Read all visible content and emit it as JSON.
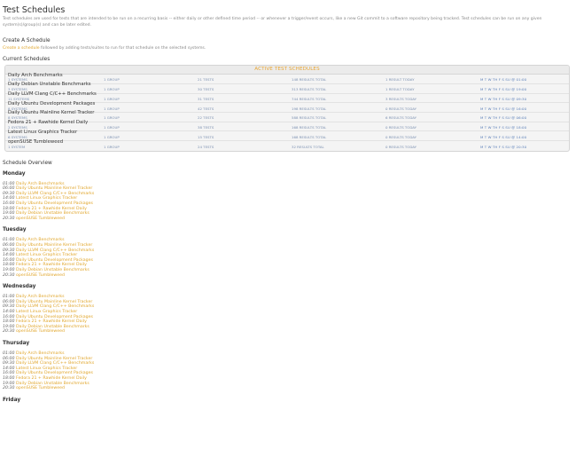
{
  "page": {
    "title": "Test Schedules",
    "intro": "Test schedules are used for tests that are intended to be run on a recurring basis -- either daily or other defined time period -- or whenever a trigger/event occurs, like a new Git commit to a software repository being tracked. Test schedules can be run on any given system(s)/group(s) and can be later edited."
  },
  "create": {
    "heading": "Create A Schedule",
    "link_text": "Create a schedule",
    "rest_text": " followed by adding tests/suites to run for that schedule on the selected systems."
  },
  "current": {
    "heading": "Current Schedules",
    "box_header": "ACTIVE TEST SCHEDULES",
    "rows": [
      {
        "name": "Daily Arch Benchmarks",
        "systems": "1 SYSTEMS",
        "groups": "1 GROUP",
        "tests": "21 TESTS",
        "results": "148 RESULTS TOTAL",
        "today": "1 RESULT TODAY",
        "when": "M T W TH F S SU @ 01:00"
      },
      {
        "name": "Daily Debian Unstable Benchmarks",
        "systems": "3 SYSTEMS",
        "groups": "1 GROUP",
        "tests": "30 TESTS",
        "results": "313 RESULTS TOTAL",
        "today": "1 RESULT TODAY",
        "when": "M T W TH F S SU @ 19:00"
      },
      {
        "name": "Daily LLVM Clang C/C++ Benchmarks",
        "systems": "11 SYSTEMS",
        "groups": "1 GROUP",
        "tests": "31 TESTS",
        "results": "744 RESULTS TOTAL",
        "today": "3 RESULTS TODAY",
        "when": "M T W TH F S SU @ 09:30"
      },
      {
        "name": "Daily Ubuntu Development Packages",
        "systems": "8 SYSTEMS",
        "groups": "1 GROUP",
        "tests": "42 TESTS",
        "results": "198 RESULTS TOTAL",
        "today": "0 RESULTS TODAY",
        "when": "M T W TH F S SU @ 16:00"
      },
      {
        "name": "Daily Ubuntu Mainline Kernel Tracker",
        "systems": "8 SYSTEMS",
        "groups": "1 GROUP",
        "tests": "22 TESTS",
        "results": "588 RESULTS TOTAL",
        "today": "6 RESULTS TODAY",
        "when": "M T W TH F S SU @ 06:00"
      },
      {
        "name": "Fedora 21 + Rawhide Kernel Daily",
        "systems": "2 SYSTEMS",
        "groups": "1 GROUP",
        "tests": "38 TESTS",
        "results": "168 RESULTS TOTAL",
        "today": "0 RESULTS TODAY",
        "when": "M T W TH F S SU @ 18:00"
      },
      {
        "name": "Latest Linux Graphics Tracker",
        "systems": "6 SYSTEMS",
        "groups": "1 GROUP",
        "tests": "15 TESTS",
        "results": "168 RESULTS TOTAL",
        "today": "0 RESULTS TODAY",
        "when": "M T W TH F S SU @ 14:00"
      },
      {
        "name": "openSUSE Tumbleweed",
        "systems": "1 SYSTEM",
        "groups": "1 GROUP",
        "tests": "24 TESTS",
        "results": "32 RESULTS TOTAL",
        "today": "0 RESULTS TODAY",
        "when": "M T W TH F S SU @ 20:30"
      }
    ]
  },
  "overview": {
    "heading": "Schedule Overview",
    "days": [
      {
        "name": "Monday",
        "entries": [
          {
            "time": "01:00",
            "name": "Daily Arch Benchmarks"
          },
          {
            "time": "06:00",
            "name": "Daily Ubuntu Mainline Kernel Tracker"
          },
          {
            "time": "09:30",
            "name": "Daily LLVM Clang C/C++ Benchmarks"
          },
          {
            "time": "14:00",
            "name": "Latest Linux Graphics Tracker"
          },
          {
            "time": "16:00",
            "name": "Daily Ubuntu Development Packages"
          },
          {
            "time": "18:00",
            "name": "Fedora 21 + Rawhide Kernel Daily"
          },
          {
            "time": "19:00",
            "name": "Daily Debian Unstable Benchmarks"
          },
          {
            "time": "20:30",
            "name": "openSUSE Tumbleweed"
          }
        ]
      },
      {
        "name": "Tuesday",
        "entries": [
          {
            "time": "01:00",
            "name": "Daily Arch Benchmarks"
          },
          {
            "time": "06:00",
            "name": "Daily Ubuntu Mainline Kernel Tracker"
          },
          {
            "time": "09:30",
            "name": "Daily LLVM Clang C/C++ Benchmarks"
          },
          {
            "time": "14:00",
            "name": "Latest Linux Graphics Tracker"
          },
          {
            "time": "16:00",
            "name": "Daily Ubuntu Development Packages"
          },
          {
            "time": "18:00",
            "name": "Fedora 21 + Rawhide Kernel Daily"
          },
          {
            "time": "19:00",
            "name": "Daily Debian Unstable Benchmarks"
          },
          {
            "time": "20:30",
            "name": "openSUSE Tumbleweed"
          }
        ]
      },
      {
        "name": "Wednesday",
        "entries": [
          {
            "time": "01:00",
            "name": "Daily Arch Benchmarks"
          },
          {
            "time": "06:00",
            "name": "Daily Ubuntu Mainline Kernel Tracker"
          },
          {
            "time": "09:30",
            "name": "Daily LLVM Clang C/C++ Benchmarks"
          },
          {
            "time": "14:00",
            "name": "Latest Linux Graphics Tracker"
          },
          {
            "time": "16:00",
            "name": "Daily Ubuntu Development Packages"
          },
          {
            "time": "18:00",
            "name": "Fedora 21 + Rawhide Kernel Daily"
          },
          {
            "time": "19:00",
            "name": "Daily Debian Unstable Benchmarks"
          },
          {
            "time": "20:30",
            "name": "openSUSE Tumbleweed"
          }
        ]
      },
      {
        "name": "Thursday",
        "entries": [
          {
            "time": "01:00",
            "name": "Daily Arch Benchmarks"
          },
          {
            "time": "06:00",
            "name": "Daily Ubuntu Mainline Kernel Tracker"
          },
          {
            "time": "09:30",
            "name": "Daily LLVM Clang C/C++ Benchmarks"
          },
          {
            "time": "14:00",
            "name": "Latest Linux Graphics Tracker"
          },
          {
            "time": "16:00",
            "name": "Daily Ubuntu Development Packages"
          },
          {
            "time": "18:00",
            "name": "Fedora 21 + Rawhide Kernel Daily"
          },
          {
            "time": "19:00",
            "name": "Daily Debian Unstable Benchmarks"
          },
          {
            "time": "20:30",
            "name": "openSUSE Tumbleweed"
          }
        ]
      },
      {
        "name": "Friday",
        "entries": []
      }
    ]
  }
}
